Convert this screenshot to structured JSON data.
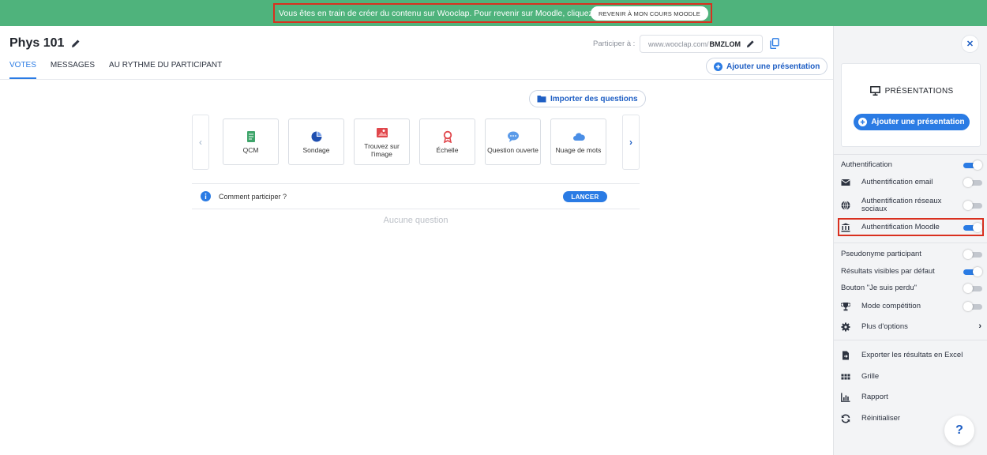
{
  "banner": {
    "message": "Vous êtes en train de créer du contenu sur Wooclap. Pour revenir sur Moodle, cliquez ici :",
    "button_label": "REVENIR À MON COURS MOODLE",
    "bg_color": "#4fb37c"
  },
  "event": {
    "title": "Phys 101",
    "tabs": [
      {
        "label": "VOTES",
        "active": true
      },
      {
        "label": "MESSAGES",
        "active": false
      },
      {
        "label": "AU RYTHME DU PARTICIPANT",
        "active": false
      }
    ]
  },
  "participate": {
    "label": "Participer à :",
    "url_prefix": "www.wooclap.com/",
    "code": "BMZLOM"
  },
  "actions": {
    "add_presentation": "Ajouter une présentation",
    "import_questions": "Importer des questions"
  },
  "question_types": [
    {
      "label": "QCM",
      "icon": "qcm-icon"
    },
    {
      "label": "Sondage",
      "icon": "pie-chart-icon"
    },
    {
      "label": "Trouvez sur l'image",
      "icon": "image-target-icon"
    },
    {
      "label": "Échelle",
      "icon": "ribbon-icon"
    },
    {
      "label": "Question ouverte",
      "icon": "speech-bubble-icon"
    },
    {
      "label": "Nuage de mots",
      "icon": "cloud-icon"
    }
  ],
  "how_to": {
    "text": "Comment participer ?",
    "launch": "LANCER"
  },
  "empty_state": "Aucune question",
  "sidebar": {
    "presentations_title": "PRÉSENTATIONS",
    "add_presentation": "Ajouter une présentation",
    "settings": [
      {
        "label": "Authentification",
        "on": true
      },
      {
        "label": "Authentification email",
        "icon": "envelope-icon",
        "on": false
      },
      {
        "label": "Authentification réseaux sociaux",
        "icon": "globe-icon",
        "on": false
      },
      {
        "label": "Authentification Moodle",
        "icon": "institution-icon",
        "on": true
      },
      {
        "label": "Pseudonyme participant",
        "on": false
      },
      {
        "label": "Résultats visibles par défaut",
        "on": true
      },
      {
        "label": "Bouton \"Je suis perdu\"",
        "on": false
      },
      {
        "label": "Mode compétition",
        "icon": "trophy-icon",
        "on": false
      },
      {
        "label": "Plus d'options",
        "icon": "gear-icon"
      }
    ],
    "tools": [
      {
        "label": "Exporter les résultats en Excel",
        "icon": "export-file-icon"
      },
      {
        "label": "Grille",
        "icon": "grid-icon"
      },
      {
        "label": "Rapport",
        "icon": "bar-chart-icon"
      },
      {
        "label": "Réinitialiser",
        "icon": "reset-icon"
      }
    ],
    "help": "?"
  },
  "colors": {
    "accent": "#2a7be4",
    "highlight_border": "#d9301f"
  }
}
